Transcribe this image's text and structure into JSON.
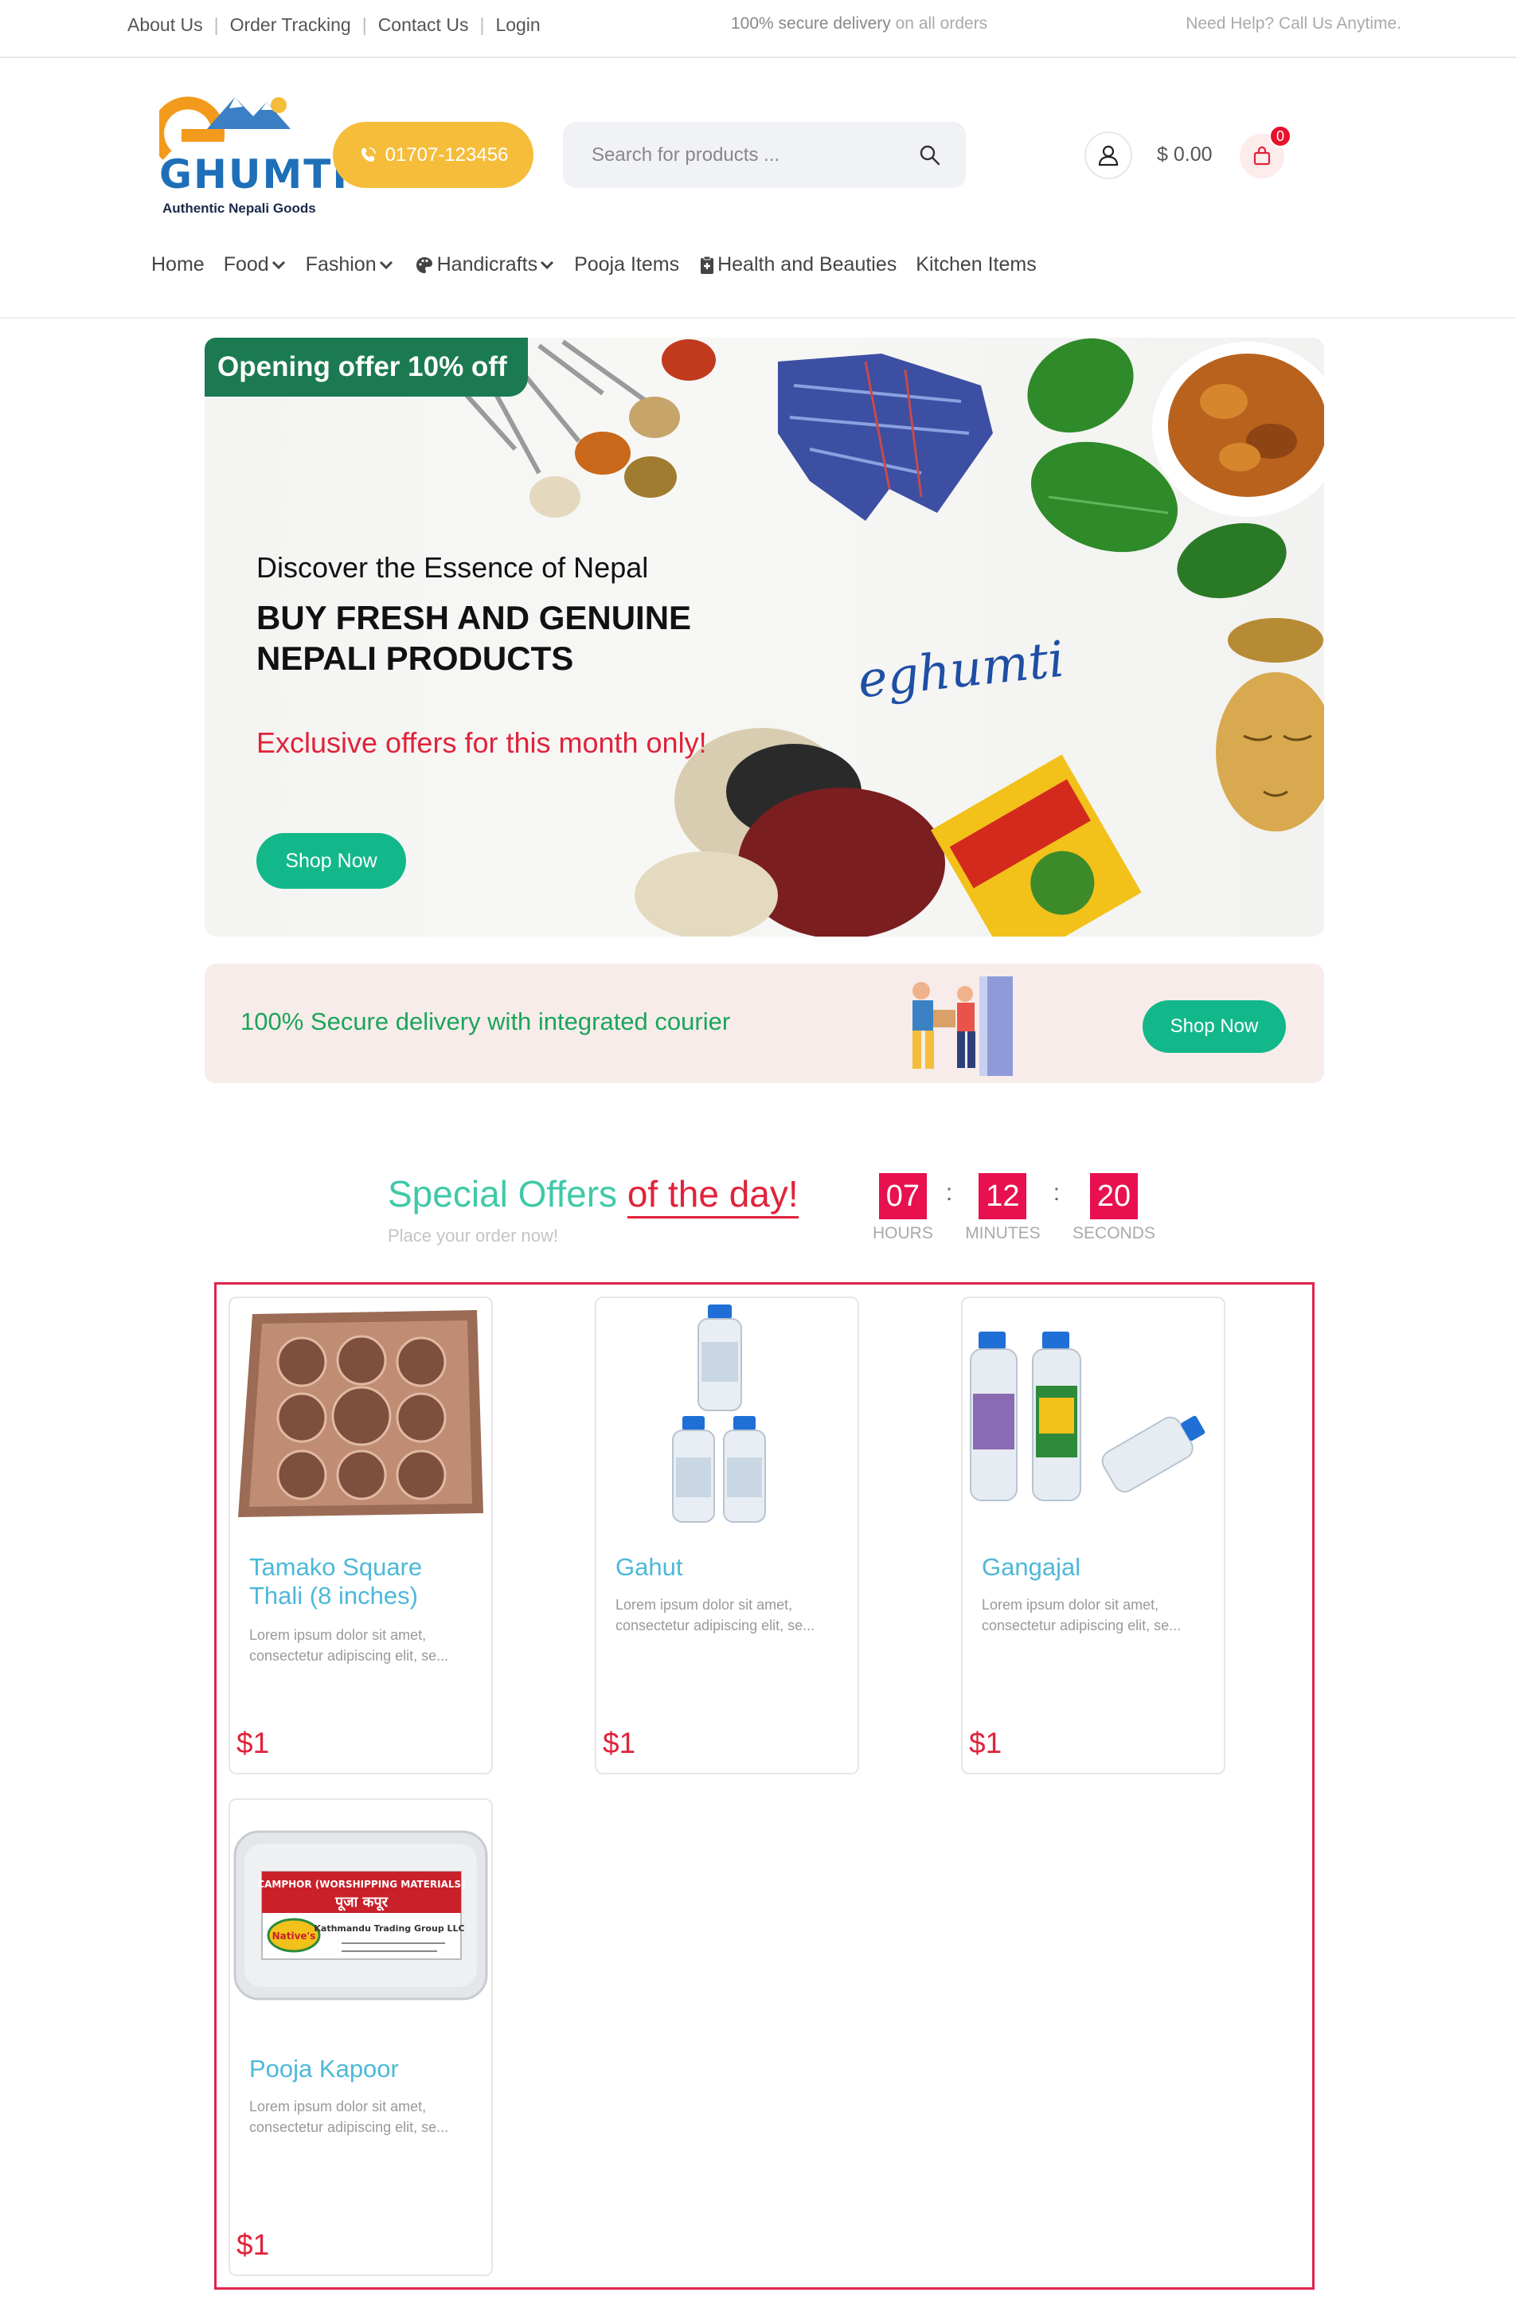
{
  "topbar": {
    "links": [
      "About Us",
      "Order Tracking",
      "Contact Us",
      "Login"
    ],
    "delivery_main": "100% secure delivery",
    "delivery_light": "on all orders",
    "help": "Need Help? Call Us Anytime."
  },
  "header": {
    "logo_text": "GHUMTI",
    "logo_tagline": "Authentic Nepali Goods",
    "phone": "01707-123456",
    "search_placeholder": "Search for products ...",
    "cart_total": "$ 0.00",
    "cart_count": "0"
  },
  "nav": {
    "home": "Home",
    "food": "Food",
    "fashion": "Fashion",
    "handicrafts": "Handicrafts",
    "pooja": "Pooja Items",
    "health": "Health and Beauties",
    "kitchen": "Kitchen Items"
  },
  "hero": {
    "badge": "Opening offer 10% off",
    "subtitle": "Discover the Essence of Nepal",
    "title_line1": "BUY FRESH AND GENUINE",
    "title_line2": "NEPALI PRODUCTS",
    "offer": "Exclusive offers for this month only!",
    "shop_label": "Shop Now",
    "brand": "eghumti"
  },
  "delivery_banner": {
    "text": "100% Secure delivery with integrated courier",
    "shop_label": "Shop Now"
  },
  "special_offers": {
    "title_main": "Special Offers",
    "title_accent": "of the day!",
    "subtitle": "Place your order now!",
    "timer": {
      "hours": "07",
      "hours_label": "HOURS",
      "minutes": "12",
      "minutes_label": "MINUTES",
      "seconds": "20",
      "seconds_label": "SECONDS"
    },
    "products": [
      {
        "name": "Tamako Square Thali (8 inches)",
        "desc": "Lorem ipsum dolor sit amet, consectetur adipiscing elit, se...",
        "price": "$1"
      },
      {
        "name": "Gahut",
        "desc": "Lorem ipsum dolor sit amet, consectetur adipiscing elit, se...",
        "price": "$1"
      },
      {
        "name": "Gangajal",
        "desc": "Lorem ipsum dolor sit amet, consectetur adipiscing elit, se...",
        "price": "$1"
      },
      {
        "name": "Pooja Kapoor",
        "desc": "Lorem ipsum dolor sit amet, consectetur adipiscing elit, se...",
        "price": "$1"
      }
    ],
    "kapoor_label_en": "CAMPHOR (WORSHIPPING MATERIALS)",
    "kapoor_label_np": "पूजा कपूर",
    "kapoor_brand": "Native's",
    "kapoor_importer": "Kathmandu Trading Group LLC"
  },
  "colors": {
    "brand_blue": "#1e6fb8",
    "accent_orange": "#f6bd3b",
    "accent_green": "#12b88a",
    "offer_red": "#e0233a",
    "teal_title": "#3fc9a8",
    "product_name_blue": "#4db8d9"
  }
}
